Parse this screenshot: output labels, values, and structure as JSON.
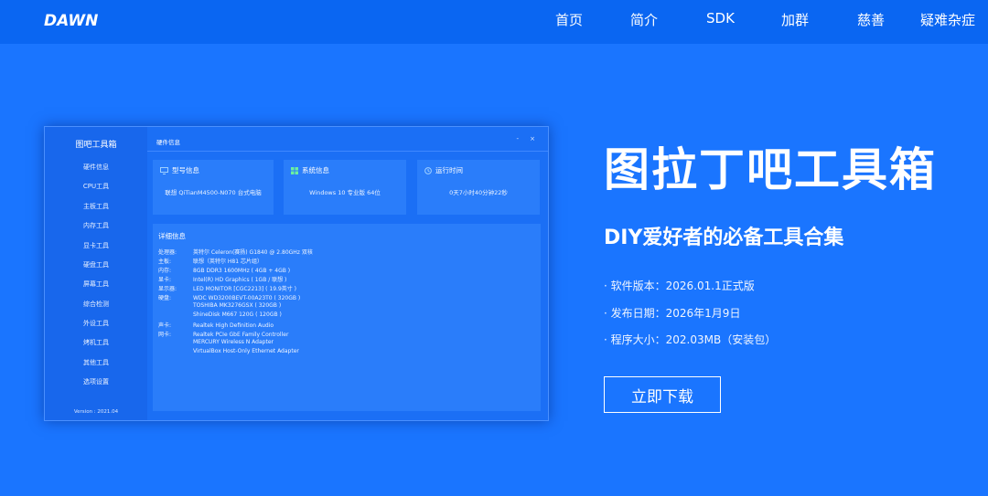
{
  "nav": {
    "logo_text": "DAWN",
    "items": [
      "首页",
      "简介",
      "SDK",
      "加群",
      "慈善",
      "疑难杂症"
    ]
  },
  "preview": {
    "brand": "图吧工具箱",
    "sidebar_items": [
      "硬件信息",
      "CPU工具",
      "主板工具",
      "内存工具",
      "显卡工具",
      "硬盘工具",
      "屏幕工具",
      "综合检测",
      "外设工具",
      "烤机工具",
      "其他工具",
      "选项设置"
    ],
    "version": "Version : 2021.04",
    "window_title": "硬件信息",
    "window_controls": [
      "-",
      "×"
    ],
    "cards": [
      {
        "icon": "monitor-icon",
        "title": "型号信息",
        "value": "联想 QiTianM4500-N070 台式电脑"
      },
      {
        "icon": "windows-icon",
        "title": "系统信息",
        "value": "Windows 10 专业版 64位"
      },
      {
        "icon": "clock-icon",
        "title": "运行时间",
        "value": "0天7小时40分钟22秒"
      }
    ],
    "detail_title": "详细信息",
    "details": [
      {
        "label": "处理器:",
        "value": "英特尔 Celeron(赛扬) G1840 @ 2.80GHz 双核"
      },
      {
        "label": "主板:",
        "value": "联想（英特尔 H81 芯片组）"
      },
      {
        "label": "内存:",
        "value": "8GB DDR3 1600MHz ( 4GB + 4GB )"
      },
      {
        "label": "显卡:",
        "value": "Intel(R) HD Graphics ( 1GB / 联想 )"
      },
      {
        "label": "显示器:",
        "value": "LED MONITOR [CGC2213] ( 19.9英寸 )"
      },
      {
        "label": "硬盘:",
        "value": "WDC WD3200BEVT-00A23T0 ( 320GB )"
      },
      {
        "label": "",
        "value": "TOSHIBA MK3276GSX ( 320GB )"
      },
      {
        "label": "",
        "value": "ShineDisk M667 120G ( 120GB )"
      },
      {
        "label": "声卡:",
        "value": "Realtek High Definition Audio"
      },
      {
        "label": "网卡:",
        "value": "Realtek PCIe GbE Family Controller"
      },
      {
        "label": "",
        "value": "MERCURY Wireless N Adapter"
      },
      {
        "label": "",
        "value": "VirtualBox Host-Only Ethernet Adapter"
      }
    ]
  },
  "hero": {
    "title": "图拉丁吧工具箱",
    "subtitle": "DIY爱好者的必备工具合集",
    "info": [
      "· 软件版本：2026.01.1正式版",
      "· 发布日期：2026年1月9日",
      "· 程序大小：202.03MB（安装包）"
    ],
    "download_label": "立即下载"
  },
  "colors": {
    "background": "#1a75ff",
    "nav": "#0a66f2",
    "panel": "#2a7dfa"
  }
}
